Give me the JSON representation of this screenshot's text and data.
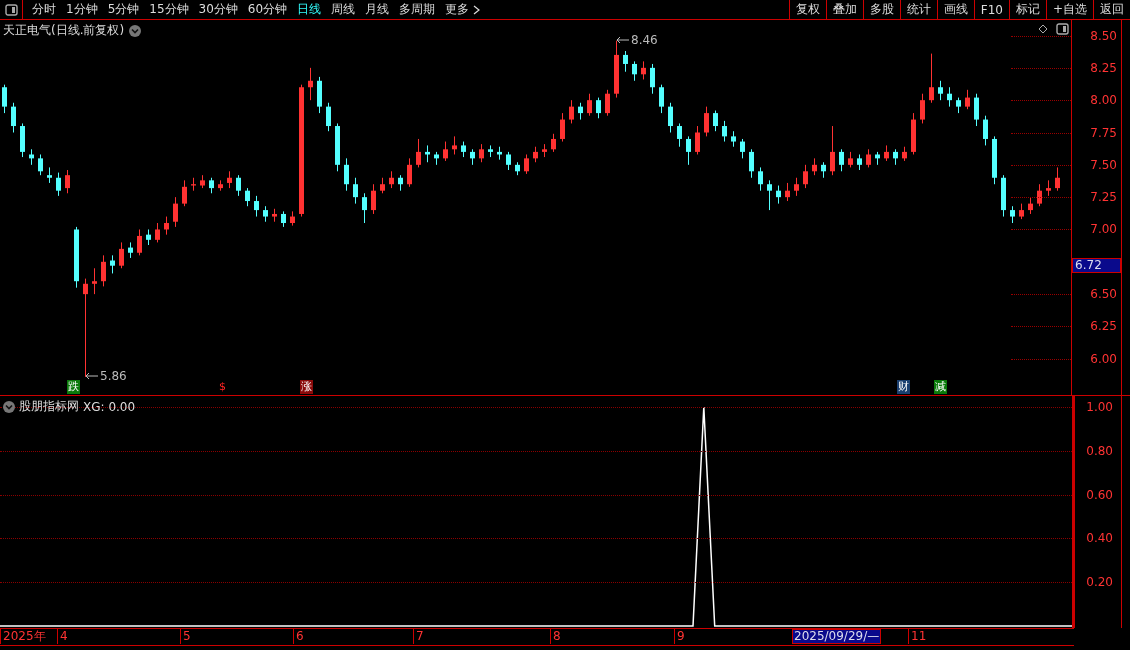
{
  "toolbar": {
    "period_tabs": [
      {
        "label": "分时",
        "selected": false
      },
      {
        "label": "1分钟",
        "selected": false
      },
      {
        "label": "5分钟",
        "selected": false
      },
      {
        "label": "15分钟",
        "selected": false
      },
      {
        "label": "30分钟",
        "selected": false
      },
      {
        "label": "60分钟",
        "selected": false
      },
      {
        "label": "日线",
        "selected": true
      },
      {
        "label": "周线",
        "selected": false
      },
      {
        "label": "月线",
        "selected": false
      },
      {
        "label": "多周期",
        "selected": false
      },
      {
        "label": "更多",
        "selected": false
      }
    ],
    "buttons": [
      "复权",
      "叠加",
      "多股",
      "统计",
      "画线",
      "F10",
      "标记",
      "+自选",
      "返回"
    ]
  },
  "price_panel": {
    "title": "天正电气(日线.前复权)",
    "current_price": "6.72",
    "high_label": "8.46",
    "low_label": "5.86",
    "event_marks": [
      {
        "text": "跌",
        "kind": "down"
      },
      {
        "text": "$",
        "kind": "dividend"
      },
      {
        "text": "涨",
        "kind": "up"
      },
      {
        "text": "财",
        "kind": "finance"
      },
      {
        "text": "减",
        "kind": "reduce"
      }
    ],
    "chart_data": {
      "type": "candlestick",
      "ylim": [
        5.72,
        8.62
      ],
      "categories": [
        null,
        null,
        null,
        null,
        null,
        null,
        null,
        null,
        null,
        null,
        null,
        null,
        null,
        null,
        null,
        null,
        null,
        null,
        null,
        null,
        null,
        null,
        null,
        null,
        null,
        null,
        null,
        null,
        null,
        null,
        null,
        null,
        null,
        null,
        null,
        null,
        null,
        null,
        null,
        null,
        null,
        null,
        null,
        null,
        null,
        null,
        null,
        null,
        null,
        null,
        null,
        null,
        null,
        null,
        null,
        null,
        null,
        null,
        null,
        null,
        null,
        null,
        null,
        null,
        null,
        null,
        null,
        null,
        null,
        null,
        null,
        null,
        null,
        null,
        null,
        null,
        null,
        null,
        null,
        null,
        null,
        null,
        null,
        null,
        null,
        null,
        null,
        null,
        null,
        null,
        null,
        null,
        null,
        null,
        null,
        null,
        null,
        null,
        null,
        null,
        null,
        null,
        null,
        null,
        null,
        null,
        null,
        null,
        null,
        null,
        null,
        null,
        null,
        null,
        null,
        null,
        null,
        null
      ],
      "yticks": [
        {
          "value": 8.5,
          "label": "8.50"
        },
        {
          "value": 8.25,
          "label": "8.25"
        },
        {
          "value": 8,
          "label": "8.00"
        },
        {
          "value": 7.75,
          "label": "7.75"
        },
        {
          "value": 7.5,
          "label": "7.50"
        },
        {
          "value": 7.25,
          "label": "7.25"
        },
        {
          "value": 7,
          "label": "7.00"
        },
        {
          "value": 6.5,
          "label": "6.50"
        },
        {
          "value": 6.25,
          "label": "6.25"
        },
        {
          "value": 6,
          "label": "6.00"
        }
      ],
      "ohlc": [
        [
          8.1,
          8.12,
          7.9,
          7.95
        ],
        [
          7.95,
          7.98,
          7.75,
          7.8
        ],
        [
          7.8,
          7.82,
          7.56,
          7.6
        ],
        [
          7.58,
          7.62,
          7.5,
          7.55
        ],
        [
          7.55,
          7.58,
          7.42,
          7.45
        ],
        [
          7.42,
          7.48,
          7.36,
          7.4
        ],
        [
          7.4,
          7.44,
          7.26,
          7.3
        ],
        [
          7.32,
          7.46,
          7.28,
          7.42
        ],
        [
          7.0,
          7.02,
          6.55,
          6.6
        ],
        [
          6.5,
          6.62,
          5.86,
          6.58
        ],
        [
          6.58,
          6.7,
          6.5,
          6.6
        ],
        [
          6.6,
          6.8,
          6.56,
          6.75
        ],
        [
          6.76,
          6.8,
          6.66,
          6.72
        ],
        [
          6.72,
          6.9,
          6.7,
          6.85
        ],
        [
          6.86,
          6.9,
          6.78,
          6.82
        ],
        [
          6.82,
          7.0,
          6.8,
          6.95
        ],
        [
          6.96,
          7.0,
          6.88,
          6.92
        ],
        [
          6.92,
          7.05,
          6.9,
          7.0
        ],
        [
          7.0,
          7.1,
          6.96,
          7.05
        ],
        [
          7.06,
          7.25,
          7.02,
          7.2
        ],
        [
          7.2,
          7.38,
          7.18,
          7.33
        ],
        [
          7.34,
          7.4,
          7.3,
          7.35
        ],
        [
          7.34,
          7.42,
          7.32,
          7.38
        ],
        [
          7.38,
          7.4,
          7.28,
          7.32
        ],
        [
          7.32,
          7.38,
          7.3,
          7.35
        ],
        [
          7.36,
          7.45,
          7.32,
          7.4
        ],
        [
          7.4,
          7.42,
          7.26,
          7.3
        ],
        [
          7.3,
          7.32,
          7.18,
          7.22
        ],
        [
          7.22,
          7.26,
          7.1,
          7.15
        ],
        [
          7.15,
          7.18,
          7.06,
          7.1
        ],
        [
          7.1,
          7.16,
          7.06,
          7.12
        ],
        [
          7.12,
          7.14,
          7.02,
          7.05
        ],
        [
          7.05,
          7.14,
          7.03,
          7.1
        ],
        [
          7.12,
          8.12,
          7.1,
          8.1
        ],
        [
          8.1,
          8.25,
          8.0,
          8.15
        ],
        [
          8.15,
          8.18,
          7.9,
          7.95
        ],
        [
          7.95,
          7.98,
          7.76,
          7.8
        ],
        [
          7.8,
          7.82,
          7.45,
          7.5
        ],
        [
          7.5,
          7.55,
          7.3,
          7.35
        ],
        [
          7.35,
          7.4,
          7.2,
          7.25
        ],
        [
          7.25,
          7.28,
          7.05,
          7.15
        ],
        [
          7.15,
          7.35,
          7.12,
          7.3
        ],
        [
          7.3,
          7.4,
          7.28,
          7.35
        ],
        [
          7.35,
          7.45,
          7.32,
          7.4
        ],
        [
          7.4,
          7.42,
          7.3,
          7.35
        ],
        [
          7.35,
          7.55,
          7.33,
          7.5
        ],
        [
          7.5,
          7.7,
          7.48,
          7.6
        ],
        [
          7.6,
          7.65,
          7.52,
          7.58
        ],
        [
          7.58,
          7.6,
          7.5,
          7.55
        ],
        [
          7.55,
          7.68,
          7.53,
          7.62
        ],
        [
          7.62,
          7.72,
          7.58,
          7.65
        ],
        [
          7.65,
          7.68,
          7.56,
          7.6
        ],
        [
          7.6,
          7.62,
          7.5,
          7.55
        ],
        [
          7.55,
          7.66,
          7.52,
          7.62
        ],
        [
          7.62,
          7.65,
          7.56,
          7.6
        ],
        [
          7.6,
          7.64,
          7.54,
          7.58
        ],
        [
          7.58,
          7.6,
          7.46,
          7.5
        ],
        [
          7.5,
          7.52,
          7.42,
          7.45
        ],
        [
          7.45,
          7.58,
          7.43,
          7.55
        ],
        [
          7.55,
          7.64,
          7.52,
          7.6
        ],
        [
          7.6,
          7.66,
          7.56,
          7.62
        ],
        [
          7.62,
          7.74,
          7.6,
          7.7
        ],
        [
          7.7,
          7.9,
          7.68,
          7.85
        ],
        [
          7.85,
          8.0,
          7.82,
          7.95
        ],
        [
          7.95,
          7.98,
          7.85,
          7.9
        ],
        [
          7.9,
          8.05,
          7.88,
          8.0
        ],
        [
          8.0,
          8.02,
          7.86,
          7.9
        ],
        [
          7.9,
          8.08,
          7.88,
          8.05
        ],
        [
          8.05,
          8.46,
          8.02,
          8.35
        ],
        [
          8.35,
          8.38,
          8.22,
          8.28
        ],
        [
          8.28,
          8.3,
          8.15,
          8.2
        ],
        [
          8.2,
          8.3,
          8.16,
          8.25
        ],
        [
          8.25,
          8.28,
          8.05,
          8.1
        ],
        [
          8.1,
          8.12,
          7.9,
          7.95
        ],
        [
          7.95,
          7.98,
          7.75,
          7.8
        ],
        [
          7.8,
          7.82,
          7.64,
          7.7
        ],
        [
          7.7,
          7.72,
          7.5,
          7.6
        ],
        [
          7.6,
          7.8,
          7.58,
          7.75
        ],
        [
          7.75,
          7.95,
          7.72,
          7.9
        ],
        [
          7.9,
          7.92,
          7.76,
          7.8
        ],
        [
          7.8,
          7.84,
          7.68,
          7.72
        ],
        [
          7.72,
          7.76,
          7.64,
          7.68
        ],
        [
          7.68,
          7.7,
          7.55,
          7.6
        ],
        [
          7.6,
          7.62,
          7.4,
          7.45
        ],
        [
          7.45,
          7.48,
          7.3,
          7.35
        ],
        [
          7.35,
          7.38,
          7.15,
          7.3
        ],
        [
          7.3,
          7.34,
          7.2,
          7.25
        ],
        [
          7.25,
          7.36,
          7.22,
          7.3
        ],
        [
          7.3,
          7.4,
          7.26,
          7.35
        ],
        [
          7.35,
          7.5,
          7.32,
          7.45
        ],
        [
          7.45,
          7.55,
          7.42,
          7.5
        ],
        [
          7.5,
          7.52,
          7.4,
          7.45
        ],
        [
          7.45,
          7.8,
          7.42,
          7.6
        ],
        [
          7.6,
          7.62,
          7.45,
          7.5
        ],
        [
          7.5,
          7.6,
          7.48,
          7.55
        ],
        [
          7.55,
          7.58,
          7.46,
          7.5
        ],
        [
          7.5,
          7.62,
          7.48,
          7.58
        ],
        [
          7.58,
          7.6,
          7.5,
          7.55
        ],
        [
          7.55,
          7.65,
          7.53,
          7.6
        ],
        [
          7.6,
          7.62,
          7.5,
          7.55
        ],
        [
          7.55,
          7.64,
          7.53,
          7.6
        ],
        [
          7.6,
          7.9,
          7.58,
          7.85
        ],
        [
          7.85,
          8.05,
          7.82,
          8.0
        ],
        [
          8.0,
          8.36,
          7.98,
          8.1
        ],
        [
          8.1,
          8.15,
          8.0,
          8.05
        ],
        [
          8.05,
          8.1,
          7.95,
          8.0
        ],
        [
          8.0,
          8.02,
          7.9,
          7.95
        ],
        [
          7.95,
          8.08,
          7.93,
          8.02
        ],
        [
          8.02,
          8.05,
          7.8,
          7.85
        ],
        [
          7.85,
          7.88,
          7.65,
          7.7
        ],
        [
          7.7,
          7.72,
          7.35,
          7.4
        ],
        [
          7.4,
          7.42,
          7.1,
          7.15
        ],
        [
          7.15,
          7.18,
          7.05,
          7.1
        ],
        [
          7.1,
          7.2,
          7.08,
          7.15
        ],
        [
          7.15,
          7.25,
          7.12,
          7.2
        ],
        [
          7.2,
          7.35,
          7.18,
          7.3
        ],
        [
          7.3,
          7.38,
          7.26,
          7.32
        ],
        [
          7.32,
          7.48,
          7.3,
          7.4
        ]
      ]
    }
  },
  "indicator_panel": {
    "name": "股朋指标网",
    "reading": "XG: 0.00",
    "chart_data": {
      "type": "line",
      "ylim": [
        0,
        1.05
      ],
      "grid": true,
      "yticks": [
        {
          "value": 1,
          "label": "1.00"
        },
        {
          "value": 0.8,
          "label": "0.80"
        },
        {
          "value": 0.6,
          "label": "0.60"
        },
        {
          "value": 0.4,
          "label": "0.40"
        },
        {
          "value": 0.2,
          "label": "0.20"
        }
      ],
      "series": [
        {
          "color": "#ffffff",
          "values": [
            0,
            0,
            0,
            0,
            0,
            0,
            0,
            0,
            0,
            0,
            0,
            0,
            0,
            0,
            0,
            0,
            0,
            0,
            0,
            0,
            0,
            0,
            0,
            0,
            0,
            0,
            0,
            0,
            0,
            0,
            0,
            0,
            0,
            0,
            0,
            0,
            0,
            0,
            0,
            0,
            0,
            0,
            0,
            0,
            0,
            0,
            0,
            0,
            0,
            0,
            0,
            0,
            0,
            0,
            0,
            0,
            0,
            0,
            0,
            0,
            0,
            0,
            0,
            0,
            0,
            1,
            0,
            0,
            0,
            0,
            0,
            0,
            0,
            0,
            0,
            0,
            0,
            0,
            0,
            0,
            0,
            0,
            0,
            0,
            0,
            0,
            0,
            0,
            0,
            0,
            0,
            0,
            0,
            0,
            0,
            0,
            0,
            0,
            0,
            0
          ]
        }
      ]
    }
  },
  "date_axis": {
    "labels": [
      "2025年",
      "4",
      "5",
      "6",
      "7",
      "8",
      "9",
      "11"
    ],
    "cursor_date": "2025/09/29/—"
  }
}
